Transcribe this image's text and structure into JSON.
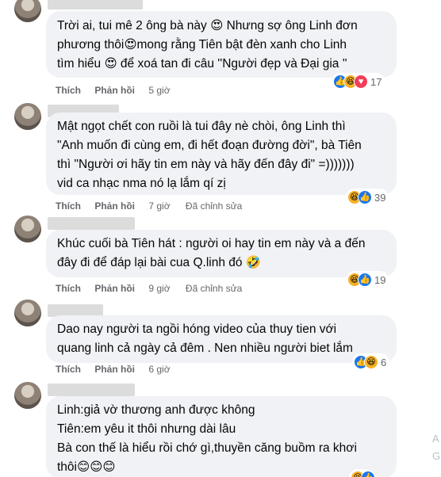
{
  "actions": {
    "like": "Thích",
    "reply": "Phản hồi",
    "edited": "Đã chỉnh sửa"
  },
  "comments": [
    {
      "lines": [
        "Trời ai, tui mê 2 ông bà này 😍 Nhưng sợ ông Linh đơn",
        "phương thôi😍mong rằng Tiên bật đèn xanh cho Linh",
        "tìm hiểu 😍 để xoá tan đi câu ''Người đẹp và Đại gia ''"
      ],
      "time": "5 giờ",
      "reactions": [
        "like",
        "haha",
        "love"
      ],
      "count": "17"
    },
    {
      "lines": [
        "Mật ngọt chết con ruồi là tui đây nè chòi, ông Linh thì",
        "\"Anh muốn đi cùng em, đi hết đoạn đường đời\", bà Tiên",
        "thì \"Người ơi hãy tin em này và hãy đến đây đi\" =)))))))",
        "vid ca nhạc nma nó lạ lắm qí zị"
      ],
      "time": "7 giờ",
      "edited": true,
      "reactions": [
        "haha",
        "like"
      ],
      "count": "39"
    },
    {
      "lines": [
        "Khúc cuối bà Tiên hát : người oi hay tin em này và a đến",
        "đây đi để đáp lại bài cua Q.linh đó 🤣"
      ],
      "time": "9 giờ",
      "edited": true,
      "reactions": [
        "haha",
        "like"
      ],
      "count": "19"
    },
    {
      "lines": [
        "Dao nay người ta ngồi hóng video của thuy tien với",
        "quang linh cả ngày cả đêm . Nen nhiều người biet lắm"
      ],
      "time": "6 giờ",
      "reactions": [
        "like",
        "haha"
      ],
      "count": "6"
    },
    {
      "lines": [
        "Linh:giả vờ thương anh được không",
        "Tiên:em yêu it thôi nhưng dài lâu",
        "Bà con thế là hiểu rồi chớ gì,thuyền căng buồm ra khơi",
        "thôi😊😊😊"
      ],
      "reactions": [
        "haha",
        "like"
      ]
    }
  ],
  "edge_chars": [
    "A",
    "G"
  ]
}
